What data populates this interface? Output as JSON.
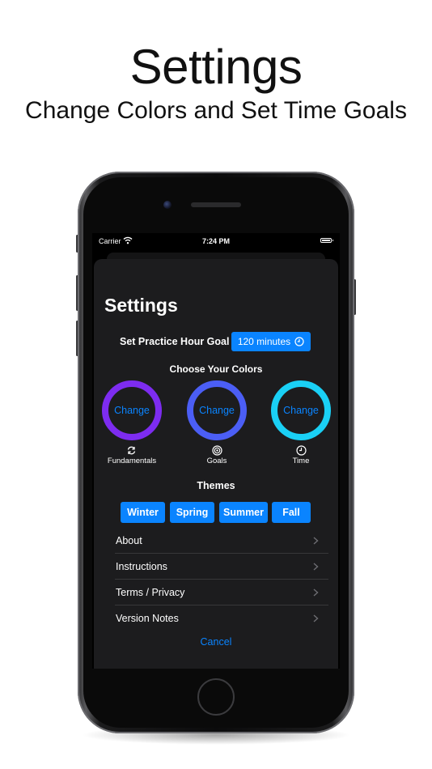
{
  "promo": {
    "headline": "Settings",
    "subheadline": "Change Colors and Set Time Goals"
  },
  "status_bar": {
    "carrier": "Carrier",
    "time": "7:24 PM"
  },
  "settings": {
    "title": "Settings",
    "goal": {
      "label": "Set Practice Hour Goal",
      "value": "120 minutes"
    },
    "colors": {
      "heading": "Choose Your Colors",
      "rings": [
        {
          "button_label": "Change",
          "caption": "Fundamentals",
          "icon": "cycle-icon",
          "color": "#7d2cf0"
        },
        {
          "button_label": "Change",
          "caption": "Goals",
          "icon": "target-icon",
          "color": "#4b5ef5"
        },
        {
          "button_label": "Change",
          "caption": "Time",
          "icon": "clock-icon",
          "color": "#1ad0f5"
        }
      ]
    },
    "themes": {
      "heading": "Themes",
      "items": [
        "Winter",
        "Spring",
        "Summer",
        "Fall"
      ]
    },
    "menu": [
      {
        "label": "About"
      },
      {
        "label": "Instructions"
      },
      {
        "label": "Terms / Privacy"
      },
      {
        "label": "Version Notes"
      }
    ],
    "cancel_label": "Cancel"
  },
  "colors": {
    "accent": "#0a84ff",
    "sheet_background": "#1c1c1e"
  }
}
